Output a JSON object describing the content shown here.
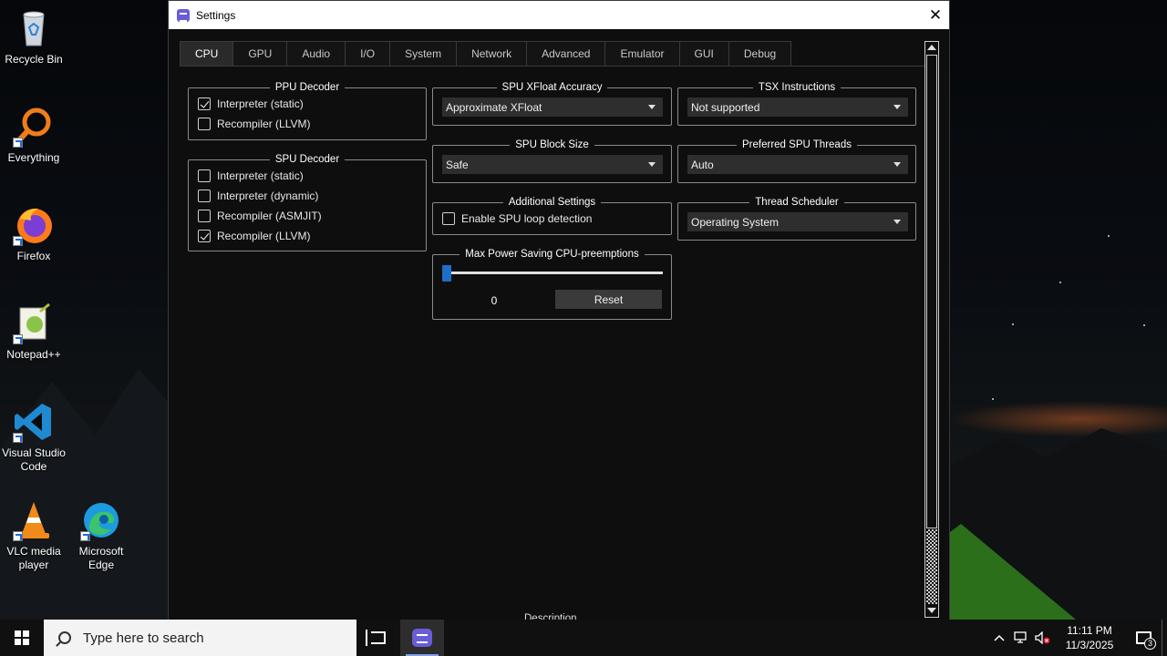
{
  "window": {
    "title": "Settings",
    "close_glyph": "✕"
  },
  "tabs": [
    "CPU",
    "GPU",
    "Audio",
    "I/O",
    "System",
    "Network",
    "Advanced",
    "Emulator",
    "GUI",
    "Debug"
  ],
  "active_tab": "CPU",
  "ppu_decoder": {
    "title": "PPU Decoder",
    "options": [
      {
        "label": "Interpreter (static)",
        "checked": true
      },
      {
        "label": "Recompiler (LLVM)",
        "checked": false
      }
    ]
  },
  "spu_decoder": {
    "title": "SPU Decoder",
    "options": [
      {
        "label": "Interpreter (static)",
        "checked": false
      },
      {
        "label": "Interpreter (dynamic)",
        "checked": false
      },
      {
        "label": "Recompiler (ASMJIT)",
        "checked": false
      },
      {
        "label": "Recompiler (LLVM)",
        "checked": true
      }
    ]
  },
  "spu_xfloat_accuracy": {
    "title": "SPU XFloat Accuracy",
    "value": "Approximate XFloat"
  },
  "tsx_instructions": {
    "title": "TSX Instructions",
    "value": "Not supported"
  },
  "spu_block_size": {
    "title": "SPU Block Size",
    "value": "Safe"
  },
  "preferred_spu_threads": {
    "title": "Preferred SPU Threads",
    "value": "Auto"
  },
  "additional_settings": {
    "title": "Additional Settings",
    "spu_loop_detection": {
      "label": "Enable SPU loop detection",
      "checked": false
    }
  },
  "thread_scheduler": {
    "title": "Thread Scheduler",
    "value": "Operating System"
  },
  "cpu_preemptions": {
    "title": "Max Power Saving CPU-preemptions",
    "value": "0",
    "slider_fraction": 0.0,
    "reset_label": "Reset"
  },
  "description_label": "Description",
  "desktop_icons": [
    {
      "label": "Recycle Bin"
    },
    {
      "label": "Everything"
    },
    {
      "label": "Firefox"
    },
    {
      "label": "Notepad++"
    },
    {
      "label": "Visual Studio Code"
    },
    {
      "label": "VLC media player"
    },
    {
      "label": "Microsoft Edge"
    }
  ],
  "taskbar": {
    "search_placeholder": "Type here to search",
    "time": "11:11 PM",
    "date": "11/3/2025",
    "notification_count": "3"
  }
}
